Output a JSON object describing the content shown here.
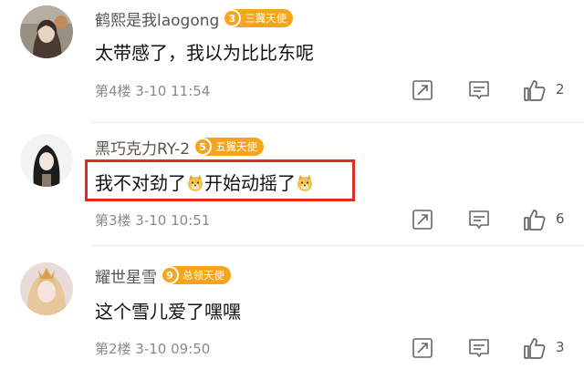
{
  "comments": [
    {
      "username": "鹤熙是我laogong",
      "badge_level": "3",
      "badge_text": "三翼天使",
      "badge_color": "#f5a41c",
      "text_parts": [
        "太带感了，我以为比比东呢"
      ],
      "meta": "第4楼  3-10 11:54",
      "like_count": "2"
    },
    {
      "username": "黑巧克力RY-2",
      "badge_level": "5",
      "badge_text": "五翼天使",
      "badge_color": "#f5a41c",
      "text_parts": [
        "我不对劲了",
        "开始动摇了"
      ],
      "meta": "第3楼  3-10 10:51",
      "like_count": "6"
    },
    {
      "username": "耀世星雪",
      "badge_level": "9",
      "badge_text": "总领天使",
      "badge_color": "#f5a41c",
      "text_parts": [
        "这个雪儿爱了嘿嘿"
      ],
      "meta": "第2楼  3-10 09:50",
      "like_count": "3"
    }
  ],
  "icons": {
    "share": "share-icon",
    "comment": "comment-icon",
    "like": "thumbs-up-icon",
    "emoji": "doge-emoji-icon"
  },
  "colors": {
    "highlight": "#e02c20",
    "badge": "#f5a41c"
  }
}
